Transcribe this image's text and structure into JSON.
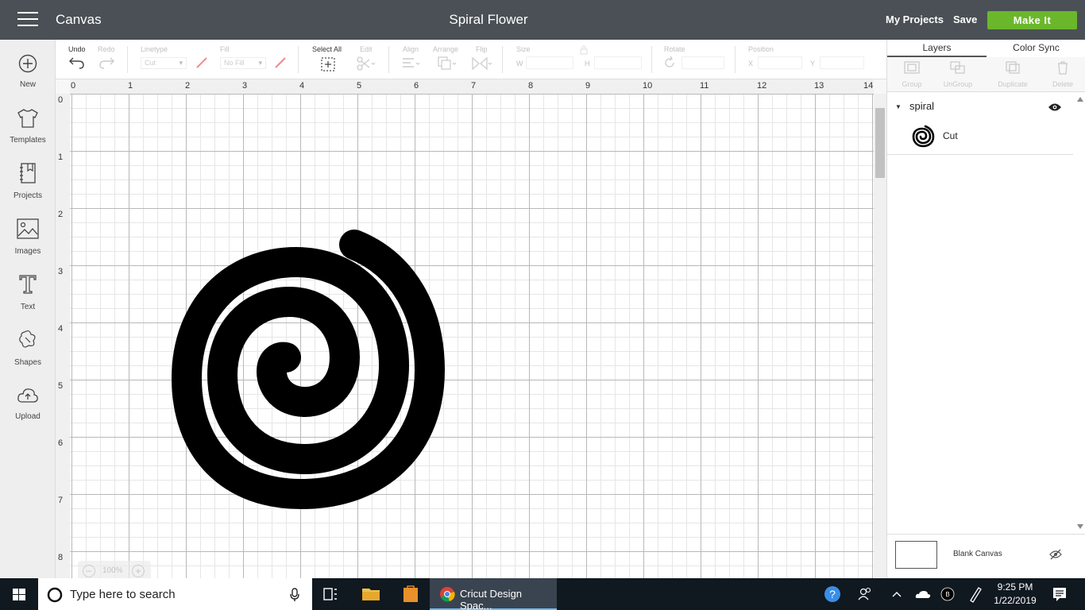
{
  "header": {
    "app_title": "Canvas",
    "project_title": "Spiral Flower",
    "my_projects": "My Projects",
    "save": "Save",
    "make_it": "Make It",
    "accent_color": "#6ab72b",
    "bar_color": "#4a5055"
  },
  "sidebar": {
    "items": [
      {
        "label": "New",
        "icon": "plus-circle-icon"
      },
      {
        "label": "Templates",
        "icon": "tshirt-icon"
      },
      {
        "label": "Projects",
        "icon": "notebook-icon"
      },
      {
        "label": "Images",
        "icon": "image-icon"
      },
      {
        "label": "Text",
        "icon": "text-icon"
      },
      {
        "label": "Shapes",
        "icon": "shapes-icon"
      },
      {
        "label": "Upload",
        "icon": "upload-icon"
      }
    ]
  },
  "toolbar": {
    "undo": "Undo",
    "redo": "Redo",
    "linetype_label": "Linetype",
    "linetype_value": "Cut",
    "fill_label": "Fill",
    "fill_value": "No Fill",
    "select_all": "Select All",
    "edit": "Edit",
    "align": "Align",
    "arrange": "Arrange",
    "flip": "Flip",
    "size": "Size",
    "size_w": "W",
    "size_h": "H",
    "rotate": "Rotate",
    "position": "Position",
    "pos_x": "X",
    "pos_y": "Y"
  },
  "canvas": {
    "ruler_top": [
      "0",
      "1",
      "2",
      "3",
      "4",
      "5",
      "6",
      "7",
      "8",
      "9",
      "10",
      "11",
      "12",
      "13",
      "14"
    ],
    "ruler_left": [
      "0",
      "1",
      "2",
      "3",
      "4",
      "5",
      "6",
      "7",
      "8"
    ],
    "zoom": "100%"
  },
  "panel": {
    "tabs": [
      "Layers",
      "Color Sync"
    ],
    "tools": [
      "Group",
      "UnGroup",
      "Duplicate",
      "Delete"
    ],
    "layer_name": "spiral",
    "layer_op": "Cut",
    "blank_canvas": "Blank Canvas"
  },
  "taskbar": {
    "search_placeholder": "Type here to search",
    "chrome_title": "Cricut Design Spac...",
    "time": "9:25 PM",
    "date": "1/22/2019"
  }
}
